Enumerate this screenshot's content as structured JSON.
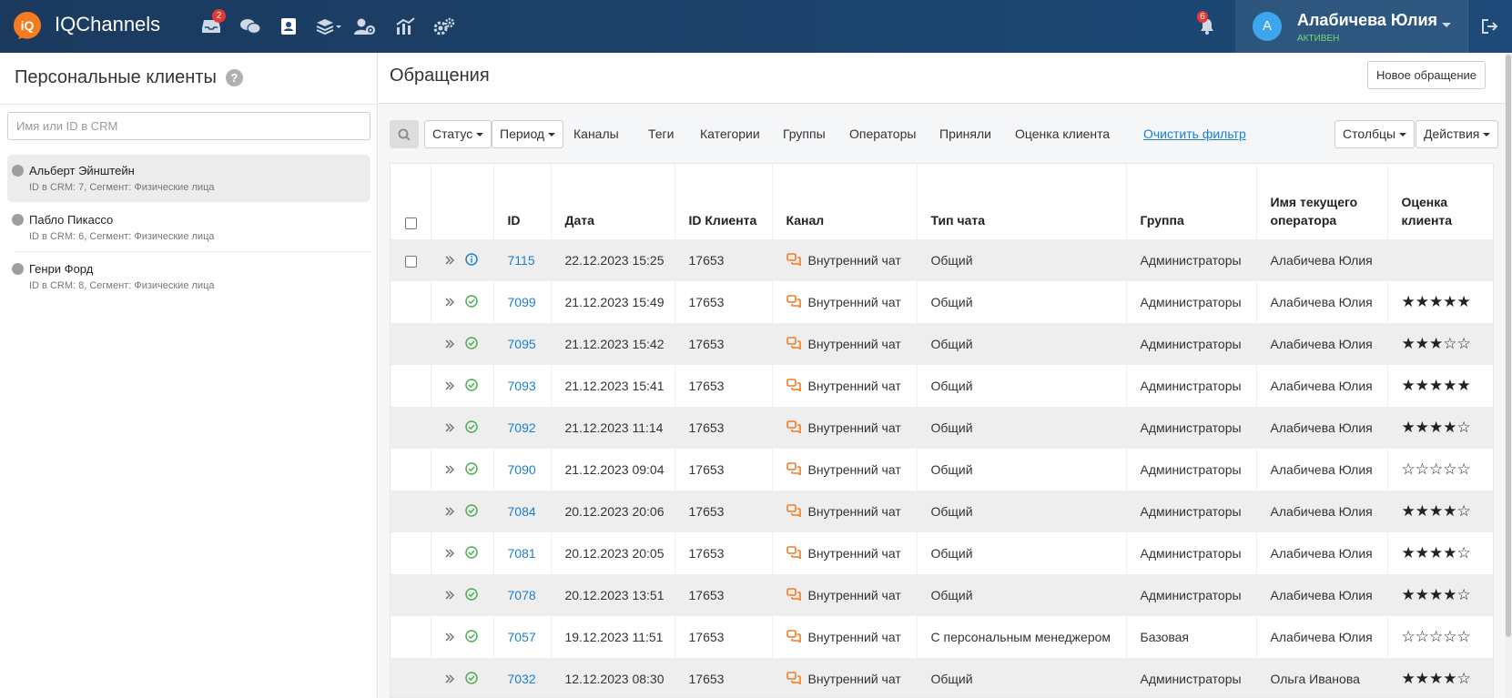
{
  "app": {
    "brand": "IQChannels",
    "logo_text": "iQ",
    "nav_badges": {
      "inbox": "2",
      "notifications": "6"
    },
    "nav_icons": [
      "inbox-icon",
      "chat-icon",
      "contacts-icon",
      "layers-icon",
      "user-settings-icon",
      "analytics-icon",
      "settings-icon"
    ]
  },
  "user": {
    "initial": "А",
    "name": "Алабичева Юлия",
    "status": "АКТИВЕН"
  },
  "left_panel": {
    "title": "Персональные клиенты",
    "search_placeholder": "Имя или ID в CRM",
    "clients": [
      {
        "name": "Альберт Эйнштейн",
        "info": "ID в CRM: 7, Сегмент: Физические лица",
        "active": true
      },
      {
        "name": "Пабло Пикассо",
        "info": "ID в CRM: 6, Сегмент: Физические лица",
        "active": false
      },
      {
        "name": "Генри Форд",
        "info": "ID в CRM: 8, Сегмент: Физические лица",
        "active": false
      }
    ]
  },
  "main": {
    "title": "Обращения",
    "new_button": "Новое обращение",
    "filters": {
      "status": "Статус",
      "period": "Период",
      "links": [
        "Каналы",
        "Теги",
        "Категории",
        "Группы",
        "Операторы",
        "Приняли",
        "Оценка клиента"
      ],
      "clear": "Очистить фильтр",
      "columns": "Столбцы",
      "actions": "Действия"
    },
    "table": {
      "headers": {
        "id": "ID",
        "date": "Дата",
        "client_id": "ID Клиента",
        "channel": "Канал",
        "chat_type": "Тип чата",
        "group": "Группа",
        "operator_line1": "Имя текущего",
        "operator_line2": "оператора",
        "rating_line1": "Оценка",
        "rating_line2": "клиента"
      },
      "rows": [
        {
          "id": "7115",
          "date": "22.12.2023 15:25",
          "client_id": "17653",
          "channel": "Внутренний чат",
          "chat_type": "Общий",
          "group": "Администраторы",
          "operator": "Алабичева Юлия",
          "rating": "",
          "status_icon": "info-icon",
          "checkbox": true
        },
        {
          "id": "7099",
          "date": "21.12.2023 15:49",
          "client_id": "17653",
          "channel": "Внутренний чат",
          "chat_type": "Общий",
          "group": "Администраторы",
          "operator": "Алабичева Юлия",
          "rating": "★★★★★",
          "status_icon": "check-circle-icon",
          "checkbox": false
        },
        {
          "id": "7095",
          "date": "21.12.2023 15:42",
          "client_id": "17653",
          "channel": "Внутренний чат",
          "chat_type": "Общий",
          "group": "Администраторы",
          "operator": "Алабичева Юлия",
          "rating": "★★★☆☆",
          "status_icon": "check-circle-icon",
          "checkbox": false
        },
        {
          "id": "7093",
          "date": "21.12.2023 15:41",
          "client_id": "17653",
          "channel": "Внутренний чат",
          "chat_type": "Общий",
          "group": "Администраторы",
          "operator": "Алабичева Юлия",
          "rating": "★★★★★",
          "status_icon": "check-circle-icon",
          "checkbox": false
        },
        {
          "id": "7092",
          "date": "21.12.2023 11:14",
          "client_id": "17653",
          "channel": "Внутренний чат",
          "chat_type": "Общий",
          "group": "Администраторы",
          "operator": "Алабичева Юлия",
          "rating": "★★★★☆",
          "status_icon": "check-circle-icon",
          "checkbox": false
        },
        {
          "id": "7090",
          "date": "21.12.2023 09:04",
          "client_id": "17653",
          "channel": "Внутренний чат",
          "chat_type": "Общий",
          "group": "Администраторы",
          "operator": "Алабичева Юлия",
          "rating": "☆☆☆☆☆",
          "status_icon": "check-circle-icon",
          "checkbox": false
        },
        {
          "id": "7084",
          "date": "20.12.2023 20:06",
          "client_id": "17653",
          "channel": "Внутренний чат",
          "chat_type": "Общий",
          "group": "Администраторы",
          "operator": "Алабичева Юлия",
          "rating": "★★★★☆",
          "status_icon": "check-circle-icon",
          "checkbox": false
        },
        {
          "id": "7081",
          "date": "20.12.2023 20:05",
          "client_id": "17653",
          "channel": "Внутренний чат",
          "chat_type": "Общий",
          "group": "Администраторы",
          "operator": "Алабичева Юлия",
          "rating": "★★★★☆",
          "status_icon": "check-circle-icon",
          "checkbox": false
        },
        {
          "id": "7078",
          "date": "20.12.2023 13:51",
          "client_id": "17653",
          "channel": "Внутренний чат",
          "chat_type": "Общий",
          "group": "Администраторы",
          "operator": "Алабичева Юлия",
          "rating": "★★★★☆",
          "status_icon": "check-circle-icon",
          "checkbox": false
        },
        {
          "id": "7057",
          "date": "19.12.2023 11:51",
          "client_id": "17653",
          "channel": "Внутренний чат",
          "chat_type": "С персональным менеджером",
          "group": "Базовая",
          "operator": "Алабичева Юлия",
          "rating": "☆☆☆☆☆",
          "status_icon": "check-circle-icon",
          "checkbox": false
        },
        {
          "id": "7032",
          "date": "12.12.2023 08:30",
          "client_id": "17653",
          "channel": "Внутренний чат",
          "chat_type": "Общий",
          "group": "Администраторы",
          "operator": "Ольга Иванова",
          "rating": "★★★★☆",
          "status_icon": "check-circle-icon",
          "checkbox": false
        }
      ]
    }
  },
  "colors": {
    "topbar": "#1b3a5e",
    "accent_orange": "#f47b20",
    "link_blue": "#1a7fd1",
    "status_green": "#4caf50",
    "badge_red": "#e53935"
  }
}
